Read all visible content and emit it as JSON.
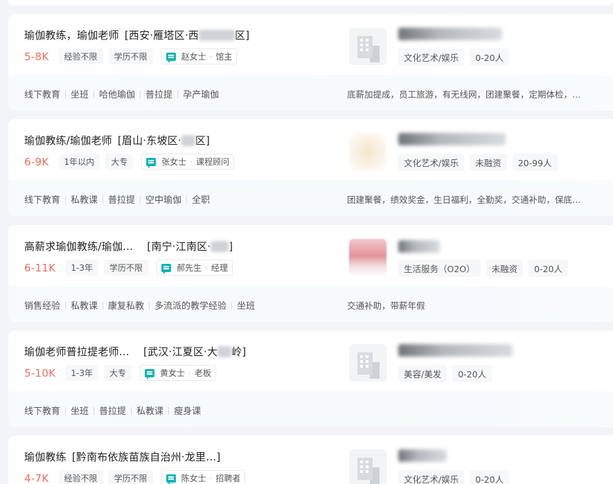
{
  "jobs": [
    {
      "title": "瑜伽教练，瑜伽老师",
      "location": "[西安·雁塔区·西",
      "location_tail": "区]",
      "salary": "5-8K",
      "tags": [
        "经验不限",
        "学历不限"
      ],
      "recruiter_name": "赵女士",
      "recruiter_role": "馆主",
      "company_tags": [
        "文化艺术/娱乐",
        "0-20人"
      ],
      "skills": [
        "线下教育",
        "坐班",
        "哈他瑜伽",
        "普拉提",
        "孕产瑜伽"
      ],
      "benefits": "底薪加提成，员工旅游，有无线网，团建聚餐，定期体检，…",
      "logo": "building-icon"
    },
    {
      "title": "瑜伽教练/瑜伽老师",
      "location": "[眉山·东坡区·",
      "location_tail": "区]",
      "salary": "6-9K",
      "tags": [
        "1年以内",
        "大专"
      ],
      "recruiter_name": "张女士",
      "recruiter_role": "课程顾问",
      "company_tags": [
        "文化艺术/娱乐",
        "未融资",
        "20-99人"
      ],
      "skills": [
        "线下教育",
        "私教课",
        "普拉提",
        "空中瑜伽",
        "全职"
      ],
      "benefits": "团建聚餐，绩效奖金，生日福利，全勤奖，交通补助，保底…",
      "logo": "warm"
    },
    {
      "title": "高薪求瑜伽教练/瑜伽…",
      "location": "[南宁·江南区·",
      "location_tail": "]",
      "salary": "6-11K",
      "tags": [
        "1-3年",
        "学历不限"
      ],
      "recruiter_name": "郝先生",
      "recruiter_role": "经理",
      "company_tags": [
        "生活服务（O2O）",
        "未融资",
        "0-20人"
      ],
      "skills": [
        "销售经验",
        "私教课",
        "康复私教",
        "多流派的教学经验",
        "坐班"
      ],
      "benefits": "交通补助，带薪年假",
      "logo": "red"
    },
    {
      "title": "瑜伽老师普拉提老师…",
      "location": "[武汉·江夏区·大",
      "location_tail": "岭]",
      "salary": "5-10K",
      "tags": [
        "1-3年",
        "大专"
      ],
      "recruiter_name": "黄女士",
      "recruiter_role": "老板",
      "company_tags": [
        "美容/美发",
        "0-20人"
      ],
      "skills": [
        "线下教育",
        "坐班",
        "普拉提",
        "私教课",
        "瘦身课"
      ],
      "benefits": "",
      "logo": "building-icon"
    },
    {
      "title": "瑜伽教练",
      "location": "[黔南布依族苗族自治州·龙里…]",
      "location_tail": "",
      "salary": "4-7K",
      "tags": [
        "经验不限",
        "学历不限"
      ],
      "recruiter_name": "陈女士",
      "recruiter_role": "招聘者",
      "company_tags": [
        "文化艺术/娱乐",
        "0-20人"
      ],
      "skills": [],
      "benefits": "",
      "logo": "building-icon"
    }
  ],
  "colors": {
    "salary": "#f26d5b",
    "chat_icon": "#11b5b4"
  }
}
